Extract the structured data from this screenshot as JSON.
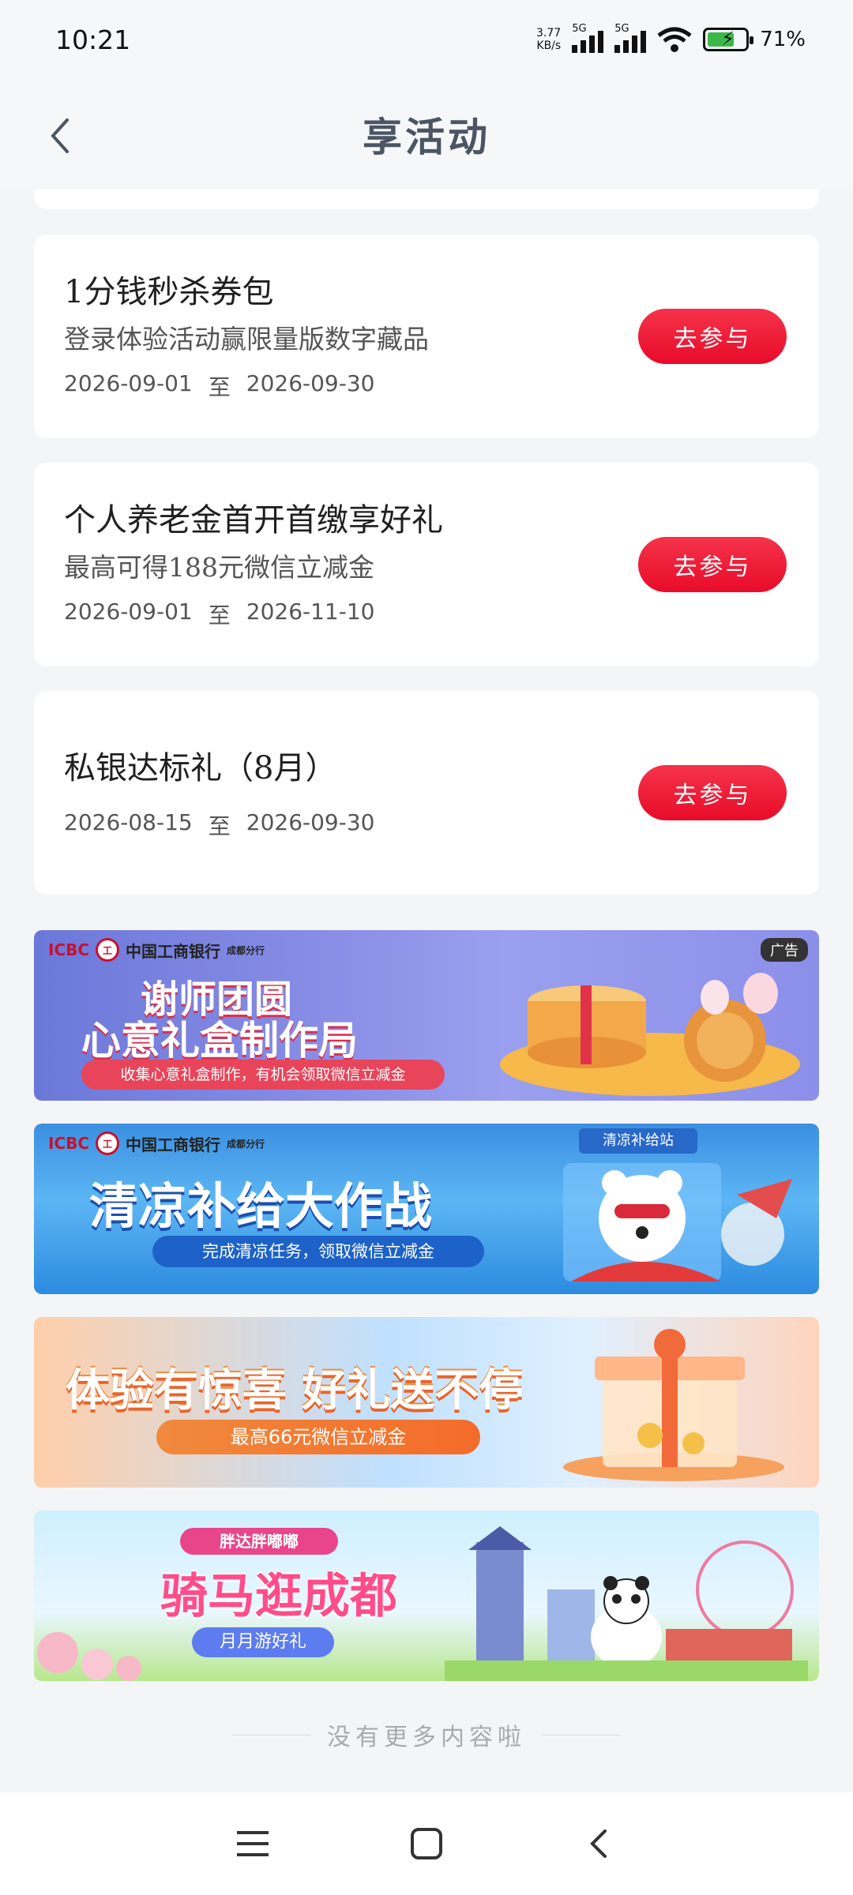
{
  "status_bar": {
    "time": "10:21",
    "net_speed_value": "3.77",
    "net_speed_unit": "KB/s",
    "signal1_label": "5G",
    "signal2_label": "5G",
    "battery_percent": "71",
    "battery_level": 0.71
  },
  "header": {
    "title": "享活动"
  },
  "activities": [
    {
      "title": "1分钱秒杀券包",
      "subtitle": "登录体验活动赢限量版数字藏品",
      "start": "2026-09-01",
      "sep": "至",
      "end": "2026-09-30",
      "button": "去参与"
    },
    {
      "title": "个人养老金首开首缴享好礼",
      "subtitle": "最高可得188元微信立减金",
      "start": "2026-09-01",
      "sep": "至",
      "end": "2026-11-10",
      "button": "去参与"
    },
    {
      "title": "私银达标礼（8月）",
      "subtitle": "",
      "start": "2026-08-15",
      "sep": "至",
      "end": "2026-09-30",
      "button": "去参与"
    }
  ],
  "banners": [
    {
      "brand": "ICBC",
      "brand_cn": "中国工商银行",
      "branch": "成都分行",
      "ad": "广告",
      "line1": "谢师团圆",
      "line2": "心意礼盒制作局",
      "desc": "收集心意礼盒制作，有机会领取微信立减金"
    },
    {
      "brand": "ICBC",
      "brand_cn": "中国工商银行",
      "branch": "成都分行",
      "tag": "清凉补给站",
      "line1": "清凉补给大作战",
      "desc": "完成清凉任务，领取微信立减金"
    },
    {
      "line1": "体验有惊喜 好礼送不停",
      "desc": "最高66元微信立减金"
    },
    {
      "top": "胖达胖嘟嘟",
      "line1": "骑马逛成都",
      "desc": "月月游好礼"
    }
  ],
  "footer": {
    "end_text": "没有更多内容啦"
  },
  "icons": {
    "back": "chevron-left-icon",
    "menu": "menu-icon",
    "home": "square-icon",
    "return": "back-icon"
  },
  "colors": {
    "accent": "#e80b2a",
    "background": "#f4f5f7"
  }
}
